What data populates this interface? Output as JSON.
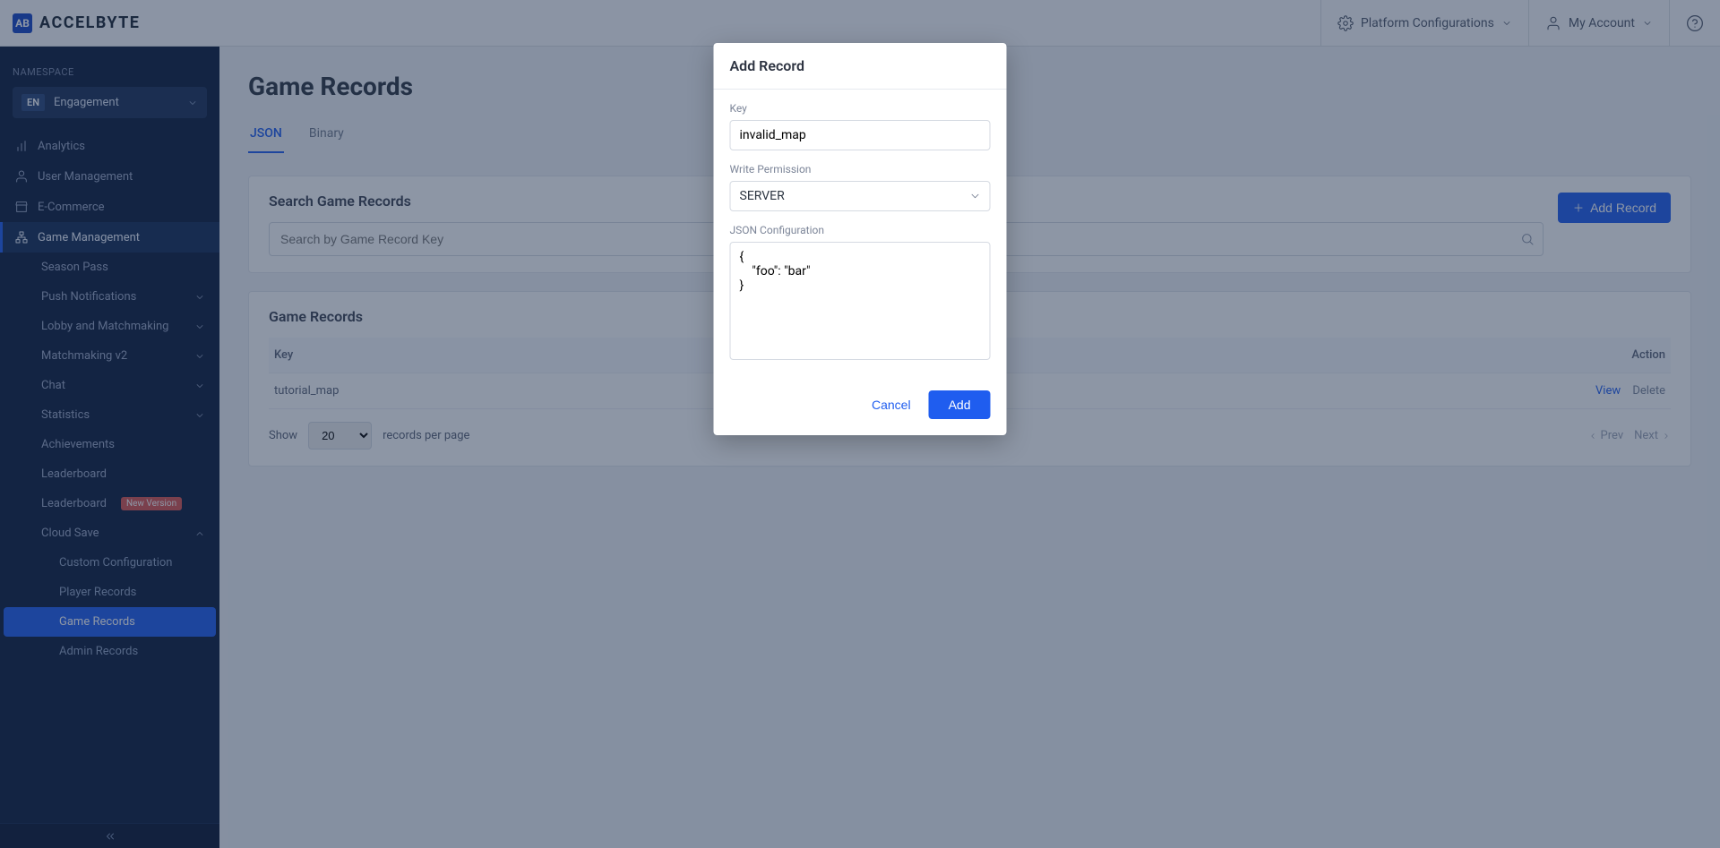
{
  "header": {
    "brand": "ACCELBYTE",
    "logo_initials": "AB",
    "platform_config": "Platform Configurations",
    "my_account": "My Account"
  },
  "sidebar": {
    "namespace_label": "NAMESPACE",
    "namespace_badge": "EN",
    "namespace_name": "Engagement",
    "items": [
      {
        "label": "Analytics"
      },
      {
        "label": "User Management"
      },
      {
        "label": "E-Commerce"
      },
      {
        "label": "Game Management"
      }
    ],
    "game_sub": [
      {
        "label": "Season Pass"
      },
      {
        "label": "Push Notifications",
        "expandable": true
      },
      {
        "label": "Lobby and Matchmaking",
        "expandable": true
      },
      {
        "label": "Matchmaking v2",
        "expandable": true
      },
      {
        "label": "Chat",
        "expandable": true
      },
      {
        "label": "Statistics",
        "expandable": true
      },
      {
        "label": "Achievements"
      },
      {
        "label": "Leaderboard"
      },
      {
        "label": "Leaderboard",
        "badge": "New Version"
      },
      {
        "label": "Cloud Save",
        "expandable": true,
        "expanded": true
      }
    ],
    "cloud_save_sub": [
      {
        "label": "Custom Configuration"
      },
      {
        "label": "Player Records"
      },
      {
        "label": "Game Records",
        "active": true
      },
      {
        "label": "Admin Records"
      }
    ]
  },
  "page": {
    "title": "Game Records",
    "tabs": {
      "json": "JSON",
      "binary": "Binary"
    },
    "search": {
      "card_title": "Search Game Records",
      "placeholder": "Search by Game Record Key",
      "add_button": "Add Record"
    },
    "table": {
      "title": "Game Records",
      "col_key": "Key",
      "col_action": "Action",
      "row0_key": "tutorial_map",
      "view": "View",
      "delete": "Delete"
    },
    "pager": {
      "show": "Show",
      "size": "20",
      "per_page": "records per page",
      "prev": "Prev",
      "next": "Next"
    }
  },
  "modal": {
    "title": "Add Record",
    "key_label": "Key",
    "key_value": "invalid_map",
    "perm_label": "Write Permission",
    "perm_value": "SERVER",
    "json_label": "JSON Configuration",
    "json_value": "{\n    \"foo\": \"bar\"\n}",
    "cancel": "Cancel",
    "add": "Add"
  }
}
